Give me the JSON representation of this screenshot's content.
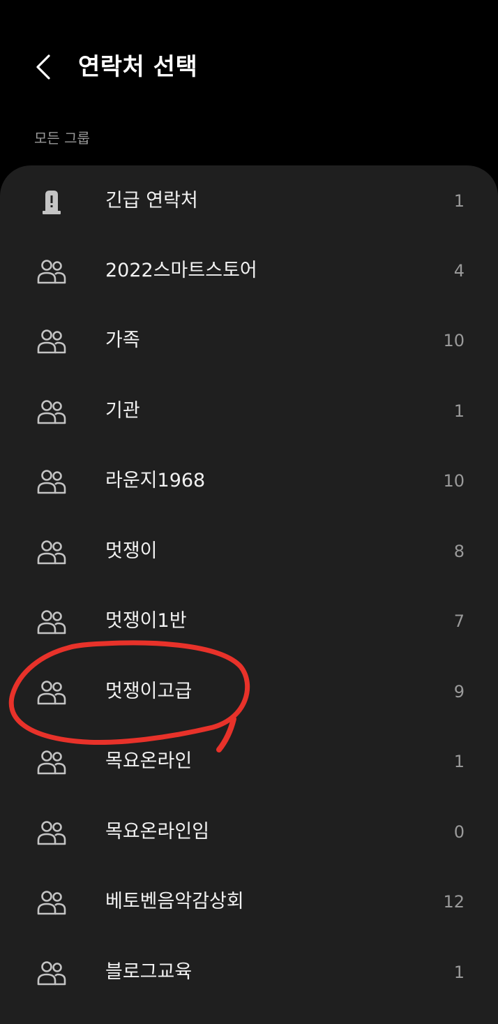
{
  "header": {
    "title": "연락처 선택",
    "back_icon": "chevron-left-icon"
  },
  "section": {
    "label": "모든 그룹"
  },
  "colors": {
    "background": "#000000",
    "card": "#1f1f1f",
    "text_primary": "#f2f2f2",
    "text_secondary": "#9a9a9a",
    "annotation": "#e8322a"
  },
  "groups": [
    {
      "label": "긴급 연락처",
      "count": "1",
      "icon": "emergency-beacon-icon"
    },
    {
      "label": "2022스마트스토어",
      "count": "4",
      "icon": "group-icon"
    },
    {
      "label": "가족",
      "count": "10",
      "icon": "group-icon"
    },
    {
      "label": "기관",
      "count": "1",
      "icon": "group-icon"
    },
    {
      "label": "라운지1968",
      "count": "10",
      "icon": "group-icon"
    },
    {
      "label": "멋쟁이",
      "count": "8",
      "icon": "group-icon"
    },
    {
      "label": "멋쟁이1반",
      "count": "7",
      "icon": "group-icon"
    },
    {
      "label": "멋쟁이고급",
      "count": "9",
      "icon": "group-icon",
      "circled": true
    },
    {
      "label": "목요온라인",
      "count": "1",
      "icon": "group-icon"
    },
    {
      "label": "목요온라인임",
      "count": "0",
      "icon": "group-icon"
    },
    {
      "label": "베토벤음악감상회",
      "count": "12",
      "icon": "group-icon"
    },
    {
      "label": "블로그교육",
      "count": "1",
      "icon": "group-icon"
    }
  ]
}
